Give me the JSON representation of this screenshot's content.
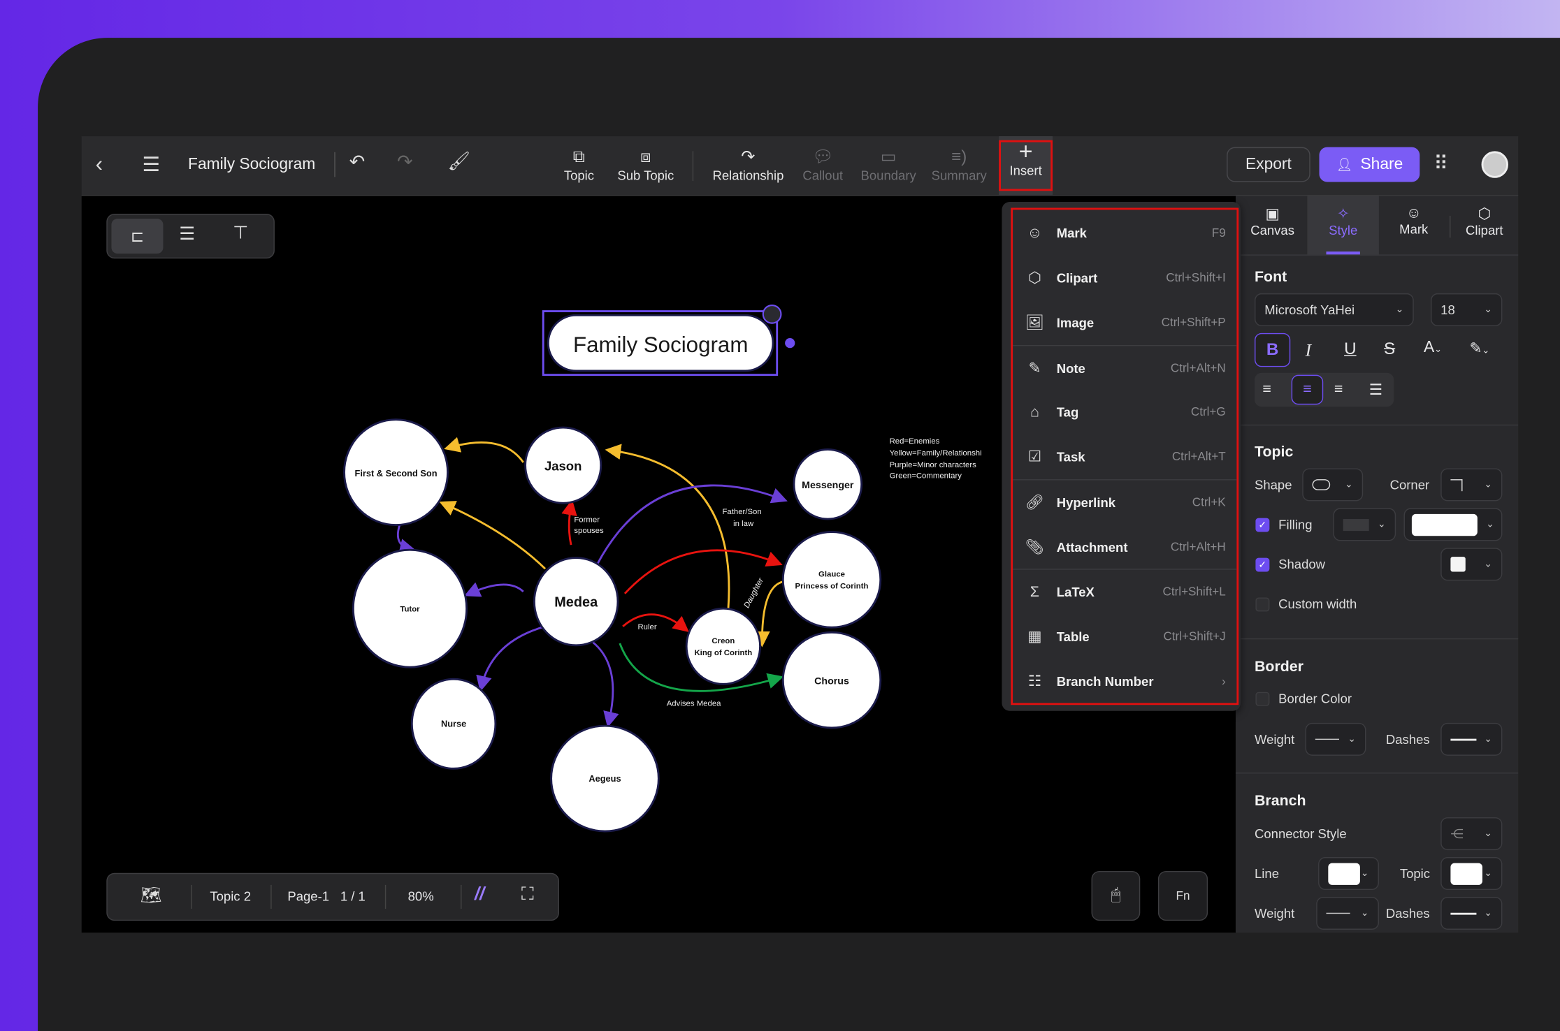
{
  "header": {
    "title": "Family Sociogram",
    "tools": [
      {
        "label": "Topic",
        "enabled": true
      },
      {
        "label": "Sub Topic",
        "enabled": true
      },
      {
        "label": "Relationship",
        "enabled": true
      },
      {
        "label": "Callout",
        "enabled": false
      },
      {
        "label": "Boundary",
        "enabled": false
      },
      {
        "label": "Summary",
        "enabled": false
      },
      {
        "label": "Insert",
        "enabled": true,
        "highlighted": true
      }
    ],
    "export_label": "Export",
    "share_label": "Share"
  },
  "insert_menu": {
    "items": [
      {
        "label": "Mark",
        "shortcut": "F9",
        "icon": "smiley-pin-icon"
      },
      {
        "label": "Clipart",
        "shortcut": "Ctrl+Shift+I",
        "icon": "clipart-icon"
      },
      {
        "label": "Image",
        "shortcut": "Ctrl+Shift+P",
        "icon": "image-icon"
      },
      {
        "label": "Note",
        "shortcut": "Ctrl+Alt+N",
        "icon": "note-icon"
      },
      {
        "label": "Tag",
        "shortcut": "Ctrl+G",
        "icon": "tag-icon"
      },
      {
        "label": "Task",
        "shortcut": "Ctrl+Alt+T",
        "icon": "task-icon"
      },
      {
        "label": "Hyperlink",
        "shortcut": "Ctrl+K",
        "icon": "link-icon"
      },
      {
        "label": "Attachment",
        "shortcut": "Ctrl+Alt+H",
        "icon": "paperclip-icon"
      },
      {
        "label": "LaTeX",
        "shortcut": "Ctrl+Shift+L",
        "icon": "sigma-icon"
      },
      {
        "label": "Table",
        "shortcut": "Ctrl+Shift+J",
        "icon": "table-icon"
      },
      {
        "label": "Branch Number",
        "shortcut": "",
        "icon": "numbered-list-icon"
      }
    ]
  },
  "map": {
    "root": "Family Sociogram",
    "nodes": {
      "sons": "First & Second Son",
      "jason": "Jason",
      "messenger": "Messenger",
      "tutor": "Tutor",
      "medea": "Medea",
      "glauce1": "Glauce",
      "glauce2": "Princess of Corinth",
      "creon1": "Creon",
      "creon2": "King of Corinth",
      "chorus": "Chorus",
      "nurse": "Nurse",
      "aegeus": "Aegeus"
    },
    "edge_labels": {
      "former1": "Former",
      "former2": "spouses",
      "fatherson1": "Father/Son",
      "fatherson2": "in law",
      "daughter": "Daughter",
      "ruler": "Ruler",
      "advises": "Advises Medea"
    },
    "legend": [
      "Red=Enemies",
      "Yellow=Family/Relationshi",
      "Purple=Minor characters",
      "Green=Commentary"
    ],
    "colors": {
      "enemies": "#e8130f",
      "family": "#f5bd2e",
      "minor": "#6a3fd6",
      "commentary": "#14a64a"
    }
  },
  "statusbar": {
    "topic": "Topic 2",
    "page": "Page-1",
    "page_count": "1 / 1",
    "zoom": "80%"
  },
  "panel": {
    "tabs": [
      "Canvas",
      "Style",
      "Mark",
      "Clipart"
    ],
    "active_tab": "Style",
    "font": {
      "title": "Font",
      "family": "Microsoft YaHei",
      "size": "18"
    },
    "topic": {
      "title": "Topic",
      "shape": "Shape",
      "corner": "Corner",
      "filling": "Filling",
      "shadow": "Shadow",
      "custom_width": "Custom width",
      "filling_checked": true,
      "shadow_checked": true,
      "custom_width_checked": false
    },
    "border": {
      "title": "Border",
      "border_color": "Border Color",
      "weight": "Weight",
      "dashes": "Dashes"
    },
    "branch": {
      "title": "Branch",
      "connector_style": "Connector Style",
      "line": "Line",
      "topic": "Topic",
      "weight": "Weight",
      "dashes": "Dashes"
    }
  },
  "accent": "#7b5cf5"
}
